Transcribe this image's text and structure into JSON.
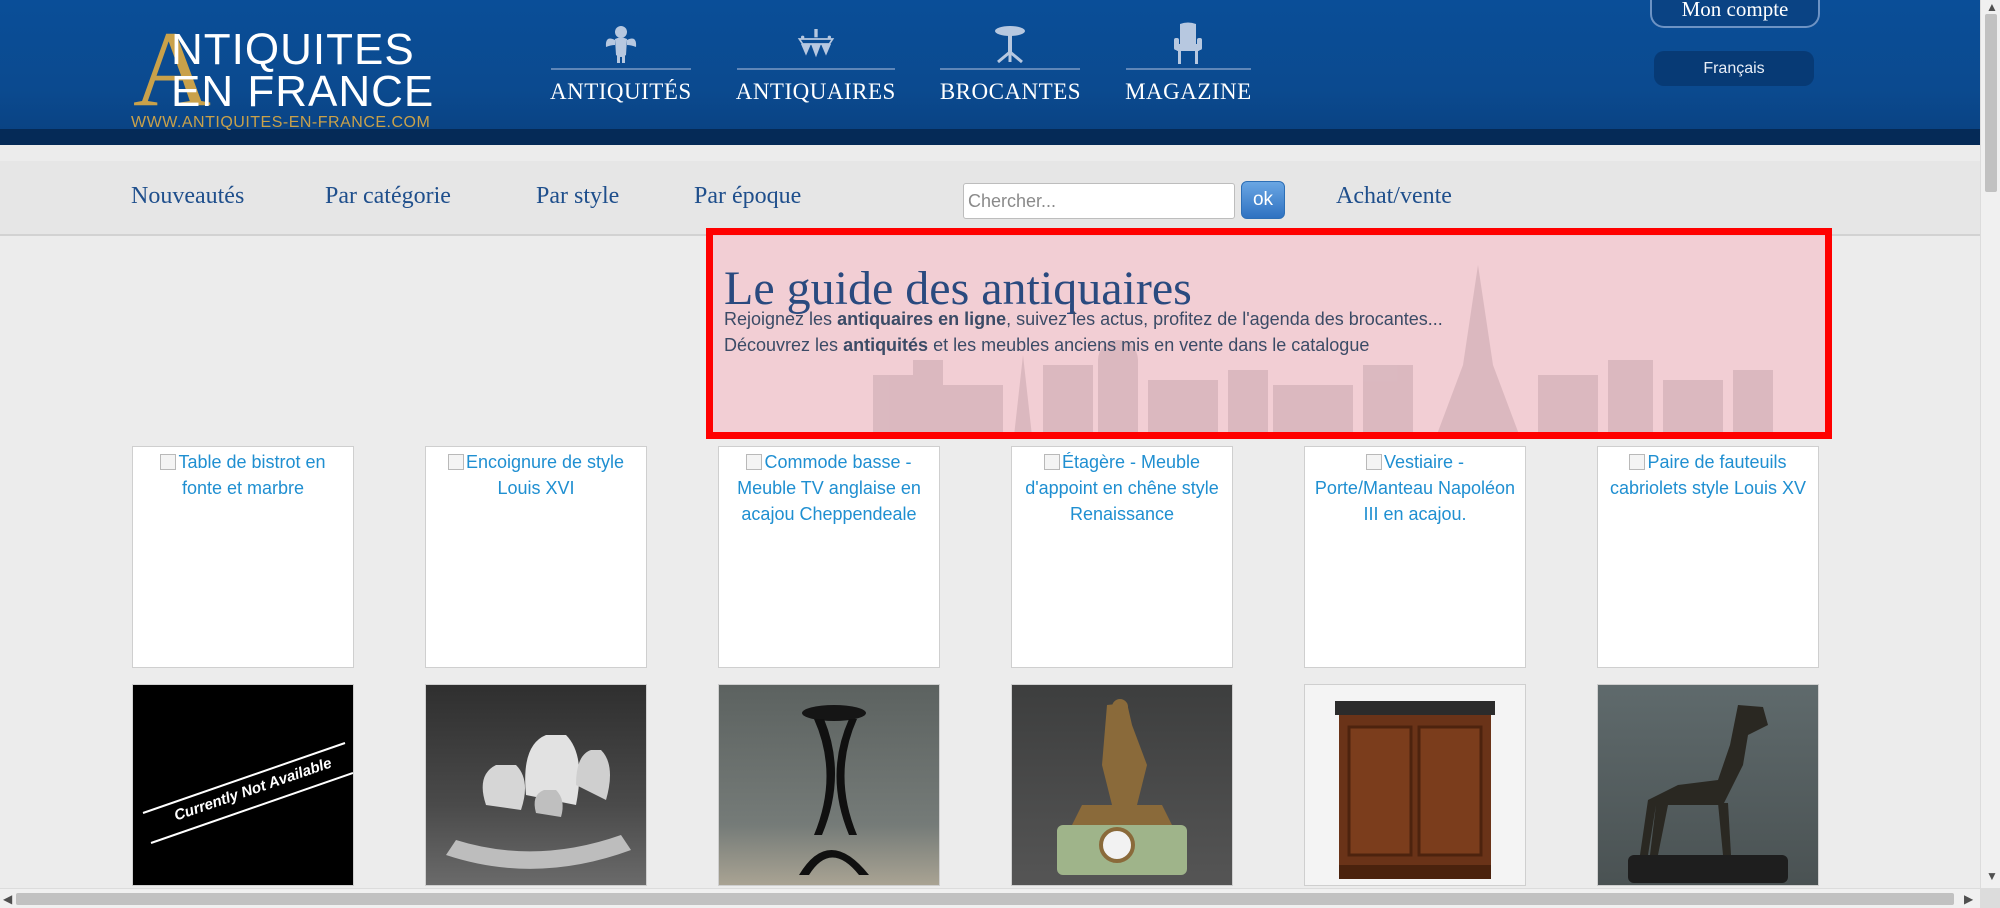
{
  "logo": {
    "big_letter": "A",
    "line1": "NTIQUITES",
    "line2": "EN FRANCE",
    "url": "WWW.ANTIQUITES-EN-FRANCE.COM"
  },
  "main_nav": [
    {
      "label": "ANTIQUITÉS",
      "icon": "cherub-icon"
    },
    {
      "label": "ANTIQUAIRES",
      "icon": "chandelier-icon"
    },
    {
      "label": "BROCANTES",
      "icon": "gueridon-table-icon"
    },
    {
      "label": "MAGAZINE",
      "icon": "armchair-icon"
    }
  ],
  "account": {
    "label": "Mon compte"
  },
  "language": {
    "label": "Français"
  },
  "sub_nav": {
    "items": [
      "Nouveautés",
      "Par catégorie",
      "Par style",
      "Par époque"
    ],
    "search_placeholder": "Chercher...",
    "search_button": "ok",
    "achat_vente": "Achat/vente"
  },
  "guide": {
    "title": "Le guide des antiquaires",
    "line1_prefix": "Rejoignez les ",
    "line1_bold": "antiquaires en ligne",
    "line1_suffix": ", suivez les actus, profitez de l'agenda des brocantes...",
    "line2_prefix": "Découvrez les ",
    "line2_bold": "antiquités",
    "line2_suffix": " et les meubles anciens mis en vente dans le catalogue"
  },
  "products_row1": [
    "Table de bistrot en fonte et marbre",
    "Encoignure de style Louis XVI",
    "Commode basse - Meuble TV anglaise en acajou Cheppendeale",
    "Étagère - Meuble d'appoint en chêne style Renaissance",
    "Vestiaire - Porte/Manteau Napoléon III en acajou.",
    "Paire de fauteuils cabriolets style Louis XV"
  ],
  "products_row2": {
    "not_available_text": "Currently Not Available"
  },
  "colors": {
    "header_blue": "#0a4e98",
    "gold": "#c9a14a",
    "link_blue": "#1f8fd1",
    "highlight_red": "#ff0000"
  }
}
